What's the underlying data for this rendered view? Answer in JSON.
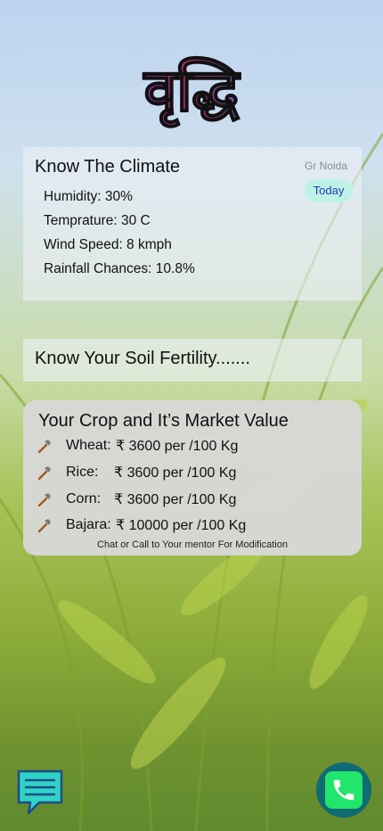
{
  "app": {
    "logo_text": "वृद्धि"
  },
  "climate": {
    "title": "Know The Climate",
    "location": "Gr Noida",
    "today_label": "Today",
    "items": [
      "Humidity: 30%",
      "Temprature: 30 C",
      "Wind Speed: 8 kmph",
      "Rainfall Chances: 10.8%"
    ]
  },
  "soil": {
    "title": "Know Your Soil Fertility......."
  },
  "market": {
    "title": "Your Crop and It’s Market Value",
    "crops": [
      {
        "name": "Wheat:",
        "price": "₹ 3600 per /100 Kg"
      },
      {
        "name": "Rice:",
        "price": "₹ 3600 per /100 Kg"
      },
      {
        "name": "Corn:",
        "price": "₹ 3600 per /100 Kg"
      },
      {
        "name": "Bajara:",
        "price": "₹ 10000 per /100 Kg"
      }
    ],
    "note": "Chat or Call to Your mentor For Modification"
  },
  "actions": {
    "chat_icon": "chat-icon",
    "call_icon": "phone-icon"
  },
  "colors": {
    "today_badge": "#bff2e6",
    "call_button": "#0f6b74",
    "call_inner": "#22e56b",
    "chat_button": "#2fd3c3"
  }
}
